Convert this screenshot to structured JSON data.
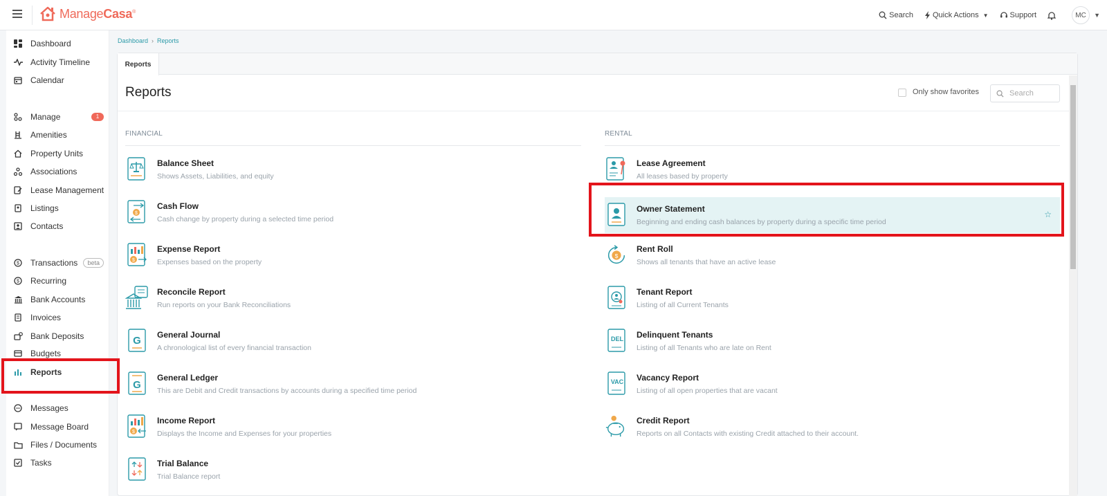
{
  "brand": {
    "name_plain": "Manage",
    "name_bold": "Casa",
    "mark": "®",
    "accent": "#ef6a5a",
    "teal": "#2b9aa8",
    "highlight": "#e3141b"
  },
  "topbar": {
    "search_label": "Search",
    "quick_actions_label": "Quick Actions",
    "support_label": "Support",
    "avatar_initials": "MC"
  },
  "sidebar": {
    "items": [
      {
        "label": "Dashboard",
        "icon": "dashboard-icon"
      },
      {
        "label": "Activity Timeline",
        "icon": "activity-icon"
      },
      {
        "label": "Calendar",
        "icon": "calendar-icon"
      },
      {
        "label": "Manage",
        "icon": "manage-icon",
        "badge": "1"
      },
      {
        "label": "Amenities",
        "icon": "amenities-icon"
      },
      {
        "label": "Property Units",
        "icon": "property-units-icon"
      },
      {
        "label": "Associations",
        "icon": "associations-icon"
      },
      {
        "label": "Lease Management",
        "icon": "lease-icon"
      },
      {
        "label": "Listings",
        "icon": "listings-icon"
      },
      {
        "label": "Contacts",
        "icon": "contacts-icon"
      },
      {
        "label": "Transactions",
        "icon": "transactions-icon",
        "tag": "beta"
      },
      {
        "label": "Recurring",
        "icon": "recurring-icon"
      },
      {
        "label": "Bank Accounts",
        "icon": "bank-icon"
      },
      {
        "label": "Invoices",
        "icon": "invoices-icon"
      },
      {
        "label": "Bank Deposits",
        "icon": "deposits-icon"
      },
      {
        "label": "Budgets",
        "icon": "budgets-icon"
      },
      {
        "label": "Reports",
        "icon": "reports-icon",
        "active": true
      },
      {
        "label": "Messages",
        "icon": "messages-icon"
      },
      {
        "label": "Message Board",
        "icon": "message-board-icon"
      },
      {
        "label": "Files / Documents",
        "icon": "folder-icon"
      },
      {
        "label": "Tasks",
        "icon": "tasks-icon"
      }
    ]
  },
  "breadcrumb": {
    "home": "Dashboard",
    "current": "Reports"
  },
  "tabs": {
    "active": "Reports"
  },
  "main": {
    "title": "Reports",
    "favorites_label": "Only show favorites",
    "search_placeholder": "Search"
  },
  "financial": {
    "heading": "FINANCIAL",
    "reports": [
      {
        "title": "Balance Sheet",
        "desc": "Shows Assets, Liabilities, and equity",
        "icon": "balance-sheet-icon"
      },
      {
        "title": "Cash Flow",
        "desc": "Cash change by property during a selected time period",
        "icon": "cash-flow-icon"
      },
      {
        "title": "Expense Report",
        "desc": "Expenses based on the property",
        "icon": "expense-report-icon"
      },
      {
        "title": "Reconcile Report",
        "desc": "Run reports on your Bank Reconciliations",
        "icon": "reconcile-icon"
      },
      {
        "title": "General Journal",
        "desc": "A chronological list of every financial transaction",
        "icon": "general-journal-icon"
      },
      {
        "title": "General Ledger",
        "desc": "This are Debit and Credit transactions by accounts during a specified time period",
        "icon": "general-ledger-icon"
      },
      {
        "title": "Income Report",
        "desc": "Displays the Income and Expenses for your properties",
        "icon": "income-report-icon"
      },
      {
        "title": "Trial Balance",
        "desc": "Trial Balance report",
        "icon": "trial-balance-icon"
      }
    ]
  },
  "rental": {
    "heading": "RENTAL",
    "reports": [
      {
        "title": "Lease Agreement",
        "desc": "All leases based by property",
        "icon": "lease-agreement-icon"
      },
      {
        "title": "Owner Statement",
        "desc": "Beginning and ending cash balances by property during a specific time period",
        "icon": "owner-statement-icon",
        "selected": true
      },
      {
        "title": "Rent Roll",
        "desc": "Shows all tenants that have an active lease",
        "icon": "rent-roll-icon"
      },
      {
        "title": "Tenant Report",
        "desc": "Listing of all Current Tenants",
        "icon": "tenant-report-icon"
      },
      {
        "title": "Delinquent Tenants",
        "desc": "Listing of all Tenants who are late on Rent",
        "icon": "delinquent-icon",
        "icon_text": "DEL"
      },
      {
        "title": "Vacancy Report",
        "desc": "Listing of all open properties that are vacant",
        "icon": "vacancy-icon",
        "icon_text": "VAC"
      },
      {
        "title": "Credit Report",
        "desc": "Reports on all Contacts with existing Credit attached to their account.",
        "icon": "credit-report-icon"
      }
    ]
  }
}
